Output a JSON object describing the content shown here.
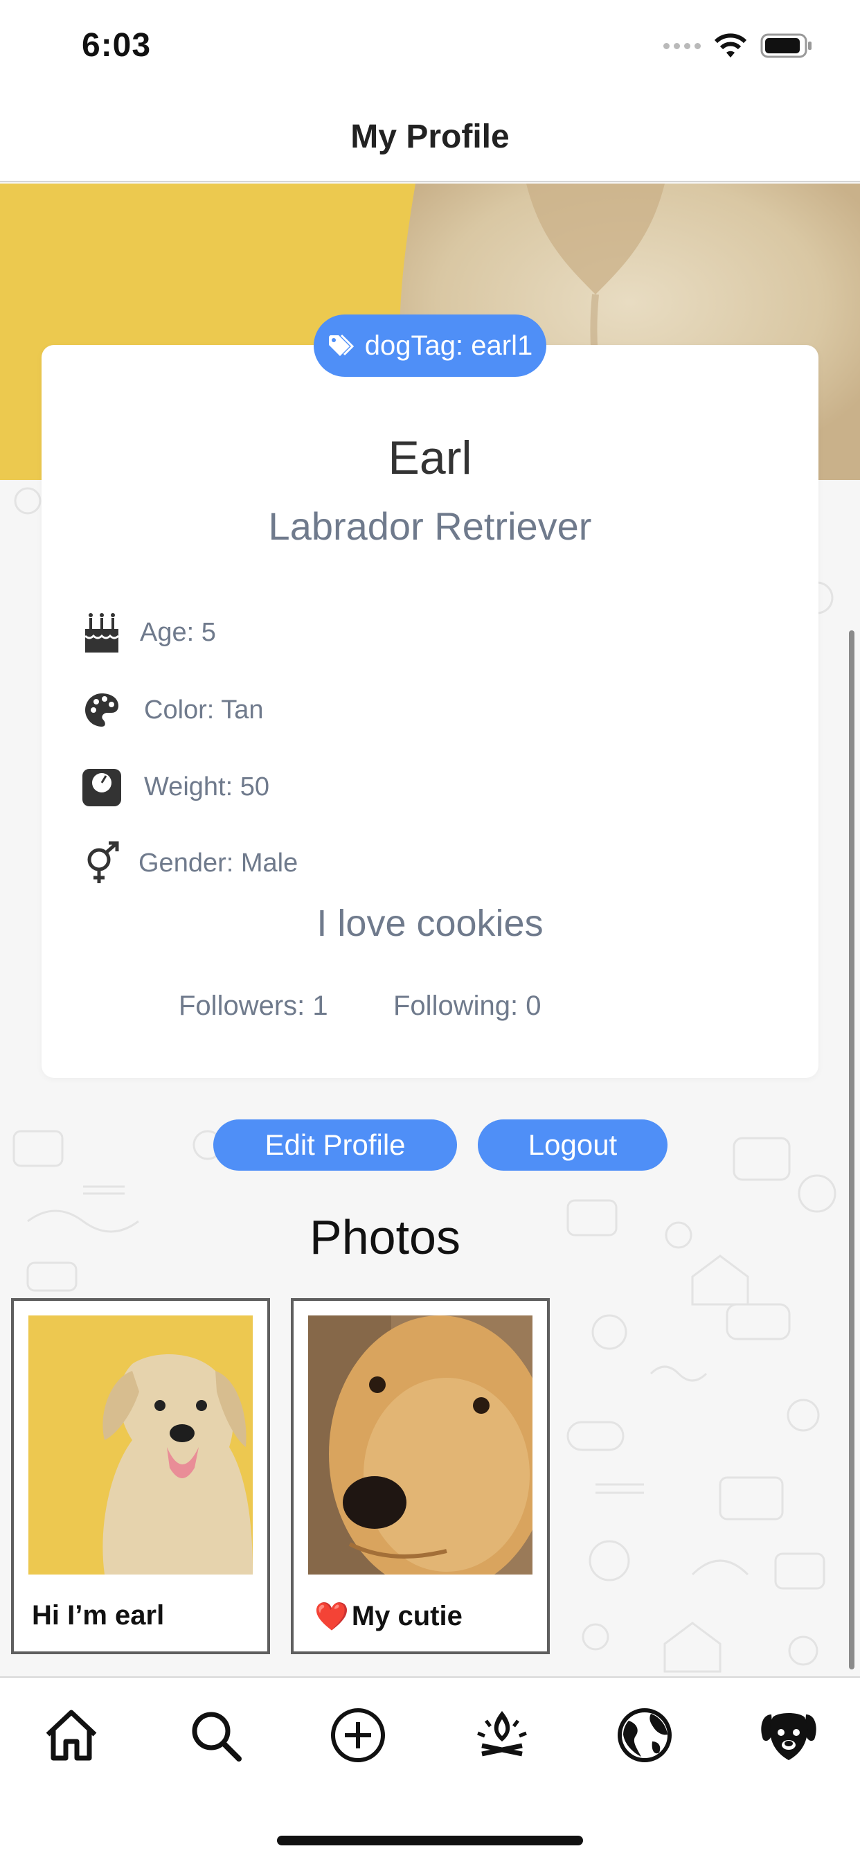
{
  "status_bar": {
    "time": "6:03"
  },
  "header": {
    "title": "My Profile"
  },
  "profile": {
    "dog_tag": "dogTag: earl1",
    "name": "Earl",
    "breed": "Labrador Retriever",
    "stats": [
      {
        "icon": "birthday-cake-icon",
        "label": "Age: 5"
      },
      {
        "icon": "palette-icon",
        "label": "Color: Tan"
      },
      {
        "icon": "weight-scale-icon",
        "label": "Weight: 50"
      },
      {
        "icon": "gender-male-female-icon",
        "label": "Gender: Male"
      }
    ],
    "bio": "I love cookies",
    "followers": "Followers: 1",
    "following": "Following: 0"
  },
  "actions": {
    "edit_label": "Edit Profile",
    "logout_label": "Logout"
  },
  "photos": {
    "heading": "Photos",
    "items": [
      {
        "caption": "Hi I’m earl"
      },
      {
        "caption": "My cutie",
        "emoji": "❤️"
      }
    ]
  },
  "tab_bar": {
    "items": [
      "home-icon",
      "search-icon",
      "add-circle-icon",
      "campfire-icon",
      "globe-icon",
      "dog-face-icon"
    ]
  },
  "colors": {
    "accent": "#4f8ff7",
    "banner": "#ecc94f",
    "muted_text": "#6f7a8c"
  }
}
